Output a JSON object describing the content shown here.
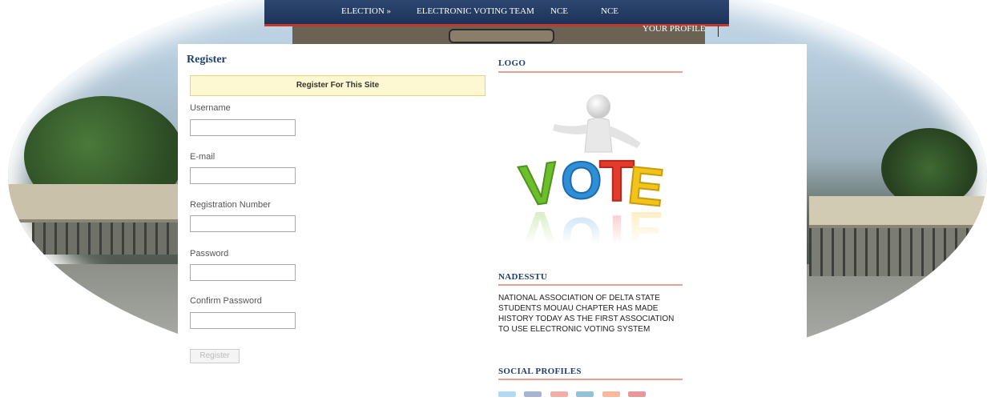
{
  "nav": {
    "items": [
      {
        "label": "ELECTION »"
      },
      {
        "label": "ELECTRONIC VOTING TEAM"
      },
      {
        "label": "NCE"
      },
      {
        "label": "NCE"
      }
    ],
    "profile_label": "YOUR PROFILE"
  },
  "register": {
    "title": "Register",
    "notice": "Register For This Site",
    "fields": [
      {
        "label": "Username",
        "value": ""
      },
      {
        "label": "E-mail",
        "value": ""
      },
      {
        "label": "Registration Number",
        "value": ""
      },
      {
        "label": "Password",
        "value": ""
      },
      {
        "label": "Confirm Password",
        "value": ""
      }
    ],
    "submit_label": "Register"
  },
  "sidebar": {
    "logo_heading": "LOGO",
    "logo_word": "VOTE",
    "nadesstu_heading": "NADESSTU",
    "nadesstu_text": "NATIONAL ASSOCIATION OF DELTA STATE STUDENTS MOUAU CHAPTER HAS MADE HISTORY TODAY AS THE FIRST ASSOCIATION TO USE ELECTRONIC VOTING SYSTEM",
    "social_heading": "SOCIAL PROFILES",
    "social_icons": [
      "twitter-icon",
      "facebook-icon",
      "google-plus-icon",
      "linkedin-icon",
      "rss-icon",
      "youtube-icon"
    ]
  },
  "colors": {
    "nav_bg": "#1c3259",
    "accent_red": "#c0392b",
    "heading_blue": "#1e3f6e",
    "notice_bg": "#fdf8d2",
    "vote_v": "#6cbf2a",
    "vote_o": "#2f8fd6",
    "vote_t": "#e23b2e",
    "vote_e": "#f2c31b"
  }
}
